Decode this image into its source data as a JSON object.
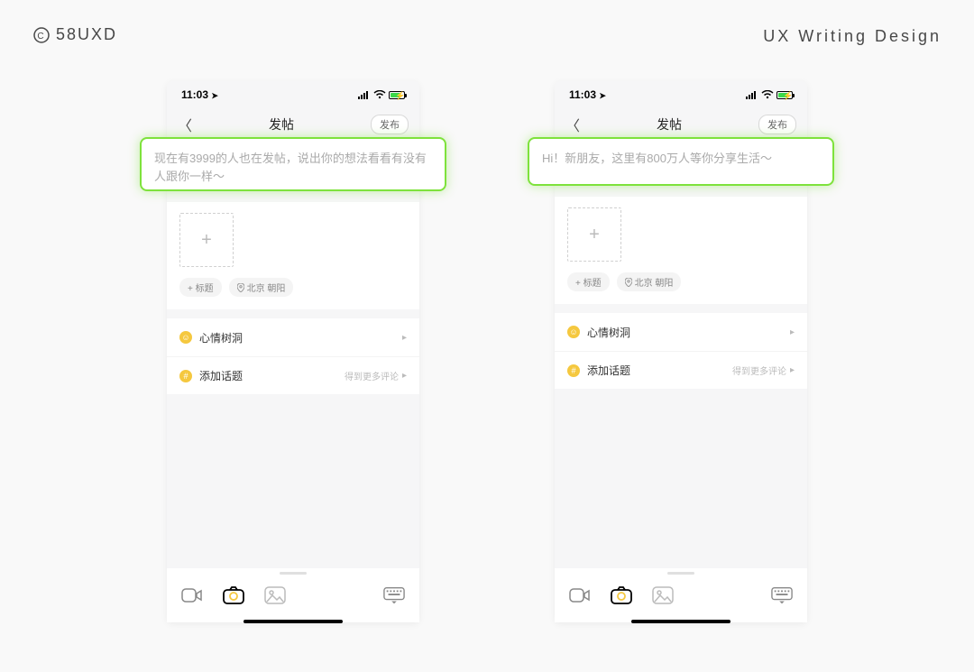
{
  "header": {
    "logo_text": "58UXD",
    "right_text": "UX Writing Design"
  },
  "status": {
    "time": "11:03",
    "arrow_glyph": "➤"
  },
  "nav": {
    "title": "发帖",
    "publish_label": "发布"
  },
  "placeholders": {
    "left": "现在有3999的人也在发帖，说出你的想法看看有没有人跟你一样～",
    "right": "Hi！新朋友，这里有800万人等你分享生活～"
  },
  "tags": {
    "add_title": "+ 标题",
    "location": "北京 朝阳"
  },
  "list": {
    "mood": "心情树洞",
    "topic": "添加话题",
    "more_hint": "得到更多评论"
  }
}
